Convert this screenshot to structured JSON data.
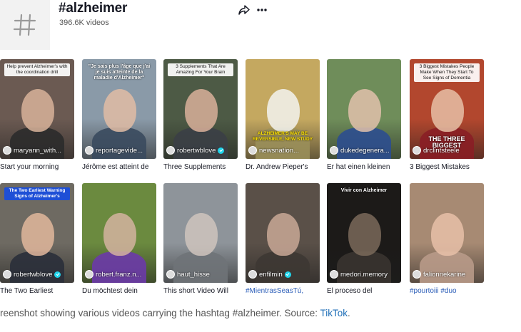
{
  "header": {
    "title": "#alzheimer",
    "count": "396.6K videos",
    "hash_icon": "hash-icon",
    "share_icon": "share-icon",
    "more_icon": "more-icon"
  },
  "videos": [
    {
      "author": "maryann_with...",
      "caption": "Start your morning",
      "caption_is_tag": false,
      "overlay": "Help prevent Alzheimer's with the coordination drill",
      "overlay_style": "white",
      "bottom": "",
      "verified": false,
      "bg": "#6b5a52",
      "face": "#d8b39a",
      "body": "#2b2b2b"
    },
    {
      "author": "reportagevide...",
      "caption": "Jérôme est atteint de",
      "caption_is_tag": false,
      "overlay": "\"Je sais plus l'âge que j'ai je suis atteinte de la maladie d'Alzheimer\"",
      "overlay_style": "dark",
      "bottom": "",
      "verified": false,
      "bg": "#8a9aa8",
      "face": "#e0bca5",
      "body": "#3a4a5e"
    },
    {
      "author": "robertwblove",
      "caption": "Three Supplements",
      "caption_is_tag": false,
      "overlay": "3 Supplements That Are Amazing For Your Brain",
      "overlay_style": "white",
      "bottom": "",
      "verified": true,
      "bg": "#4d5a45",
      "face": "#d9b09a",
      "body": "#3b3f46"
    },
    {
      "author": "newsnation...",
      "caption": "Dr. Andrew Pieper's",
      "caption_is_tag": false,
      "overlay": "",
      "overlay_style": "none",
      "bottom": "ALZHEIMER'S MAY BE REVERSIBLE, NEW STUDY",
      "verified": false,
      "bg": "#c4a860",
      "face": "#f3f3f0",
      "body": "#9a8f5a"
    },
    {
      "author": "dukedegenera...",
      "caption": "Er hat einen kleinen",
      "caption_is_tag": false,
      "overlay": "",
      "overlay_style": "none",
      "bottom": "",
      "verified": false,
      "bg": "#6f8d5a",
      "face": "#e2c1ab",
      "body": "#2c4e8f"
    },
    {
      "author": "drclintsteele",
      "caption": "3 Biggest Mistakes",
      "caption_is_tag": false,
      "overlay": "3 Biggest Mistakes People Make When They Start To See Signs of Dementia",
      "overlay_style": "white",
      "bottom": "THE THREE BIGGEST",
      "verified": false,
      "bg": "#b2472e",
      "face": "#e6c0a6",
      "body": "#8a1e25"
    },
    {
      "author": "robertwblove",
      "caption": "The Two Earliest",
      "caption_is_tag": false,
      "overlay": "The Two Earliest Warning Signs of Alzheimer's",
      "overlay_style": "blue",
      "bottom": "",
      "verified": true,
      "bg": "#6e6a62",
      "face": "#e2b79c",
      "body": "#2a2f3a"
    },
    {
      "author": "robert.franz.n...",
      "caption": "Du möchtest dein",
      "caption_is_tag": false,
      "overlay": "",
      "overlay_style": "none",
      "bottom": "",
      "verified": false,
      "bg": "#6b8a3f",
      "face": "#d4b3a0",
      "body": "#6b3aa8"
    },
    {
      "author": "haut_hisse",
      "caption": "This short Video Will",
      "caption_is_tag": false,
      "overlay": "",
      "overlay_style": "none",
      "bottom": "",
      "verified": false,
      "bg": "#8e949a",
      "face": "#cfc4bd",
      "body": "#6f7378"
    },
    {
      "author": "enfilmin",
      "caption": "#MientrasSeasTú,",
      "caption_is_tag": true,
      "overlay": "",
      "overlay_style": "none",
      "bottom": "",
      "verified": true,
      "bg": "#5a5048",
      "face": "#c9a896",
      "body": "#3d3733"
    },
    {
      "author": "medori.memory",
      "caption": "El proceso del",
      "caption_is_tag": false,
      "overlay": "Vivir con Alzheimer",
      "overlay_style": "dark",
      "bottom": "",
      "verified": false,
      "bg": "#1c1a18",
      "face": "#7a6a5a",
      "body": "#3a3430"
    },
    {
      "author": "falionnekarine",
      "caption": "#pourtoiii #duo",
      "caption_is_tag": true,
      "overlay": "",
      "overlay_style": "none",
      "bottom": "",
      "verified": false,
      "bg": "#a78a73",
      "face": "#e8c0a8",
      "body": "#b89a88"
    }
  ],
  "footer": {
    "text": "reenshot showing various videos carrying the hashtag #alzheimer. Source: ",
    "link": "TikTok",
    "end": "."
  }
}
